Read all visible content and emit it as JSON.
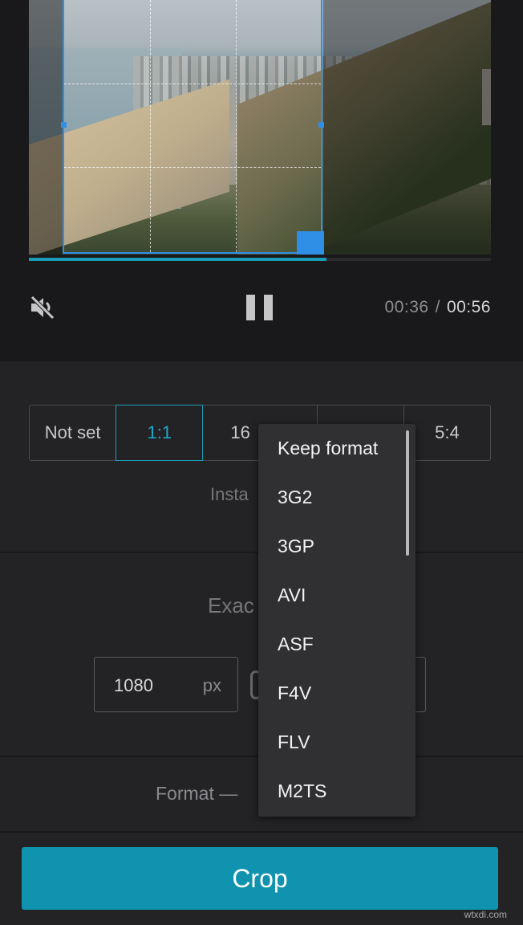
{
  "player": {
    "current_time": "00:36",
    "separator": "/",
    "duration": "00:56",
    "progress_fraction": 0.644,
    "mute_icon": "volume-muted-icon",
    "pause_icon": "pause-icon"
  },
  "aspect_ratios": {
    "options": [
      "Not set",
      "1:1",
      "16",
      "",
      "5:4"
    ],
    "selected": "1:1"
  },
  "instant_label": "Insta",
  "exact_label": "Exac",
  "size": {
    "width_value": "1080",
    "width_unit": "px"
  },
  "format_label": "Format —",
  "format_dropdown": {
    "items": [
      "Keep format",
      "3G2",
      "3GP",
      "AVI",
      "ASF",
      "F4V",
      "FLV",
      "M2TS"
    ]
  },
  "crop_button": "Crop",
  "watermark": "wtxdi.com",
  "colors": {
    "accent": "#1a9bb8",
    "crop_handle": "#2f8fe6",
    "button": "#0f93ae"
  }
}
